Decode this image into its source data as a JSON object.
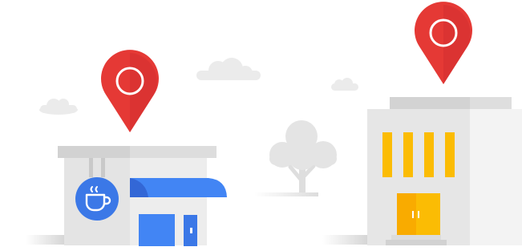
{
  "illustration": {
    "icons": {
      "pin": "map-pin-icon",
      "coffee": "coffee-cup-icon",
      "cloud": "cloud-icon",
      "tree": "tree-icon",
      "shop": "coffee-shop-building",
      "office": "office-building"
    },
    "colors": {
      "pin_red": "#e53935",
      "pin_dark": "#c62828",
      "awning_blue": "#4285f4",
      "awning_dark": "#3367d6",
      "coffee_badge": "#3b78e7",
      "window_yellow": "#fbbc04",
      "window_orange": "#f9a825",
      "building_light": "#eeeeee",
      "building_mid": "#e0e0e0",
      "building_shade": "#d5d5d5",
      "cloud": "#e8e8e8"
    }
  }
}
